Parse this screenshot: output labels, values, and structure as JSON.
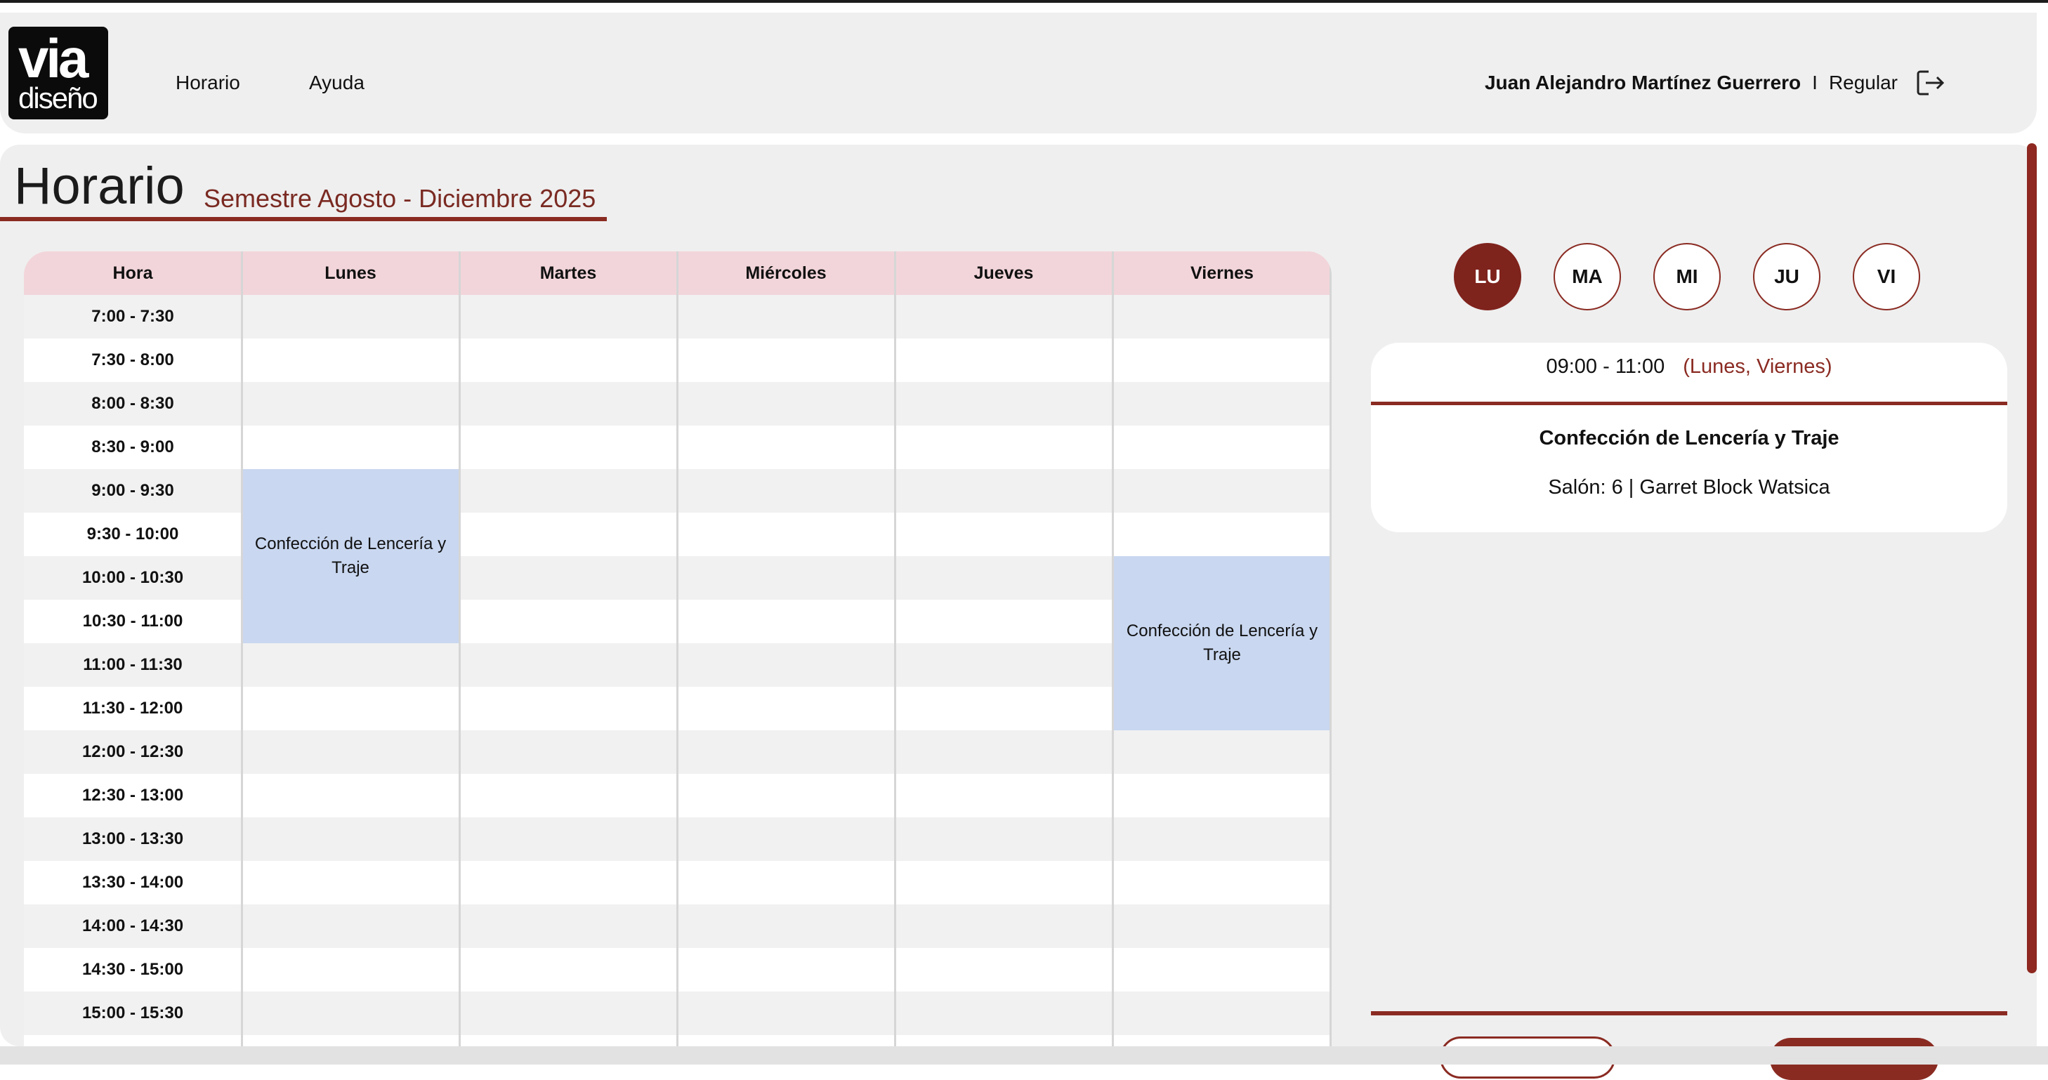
{
  "brand": {
    "line1": "via",
    "line2": "diseño"
  },
  "nav": [
    {
      "label": "Horario"
    },
    {
      "label": "Ayuda"
    }
  ],
  "user": {
    "name": "Juan Alejandro Martínez Guerrero",
    "separator": "I",
    "role": "Regular",
    "logout_icon": "logout-icon"
  },
  "page": {
    "title": "Horario",
    "semester": "Semestre Agosto - Diciembre 2025"
  },
  "timetable": {
    "headers": [
      "Hora",
      "Lunes",
      "Martes",
      "Miércoles",
      "Jueves",
      "Viernes"
    ],
    "times": [
      "7:00 - 7:30",
      "7:30 - 8:00",
      "8:00 - 8:30",
      "8:30 - 9:00",
      "9:00 - 9:30",
      "9:30 - 10:00",
      "10:00 - 10:30",
      "10:30 - 11:00",
      "11:00 - 11:30",
      "11:30 - 12:00",
      "12:00 - 12:30",
      "12:30 - 13:00",
      "13:00 - 13:30",
      "13:30 - 14:00",
      "14:00 - 14:30",
      "14:30 - 15:00",
      "15:00 - 15:30"
    ],
    "classes": [
      {
        "day": "Lunes",
        "start": "9:00",
        "end": "11:00",
        "label": "Confección de Lencería y Traje"
      },
      {
        "day": "Viernes",
        "start": "10:00",
        "end": "12:00",
        "label": "Confección de Lencería y Traje"
      }
    ]
  },
  "days": [
    {
      "label": "LU",
      "active": true
    },
    {
      "label": "MA",
      "active": false
    },
    {
      "label": "MI",
      "active": false
    },
    {
      "label": "JU",
      "active": false
    },
    {
      "label": "VI",
      "active": false
    }
  ],
  "detail": {
    "time": "09:00 - 11:00",
    "days": "(Lunes, Viernes)",
    "subject": "Confección de Lencería y Traje",
    "room": "Salón: 6 | Garret Block Watsica"
  },
  "colors": {
    "accent": "#8a2b22",
    "class_block": "#c9d7f0",
    "header_row": "#f2d5da",
    "panel": "#efefef"
  }
}
